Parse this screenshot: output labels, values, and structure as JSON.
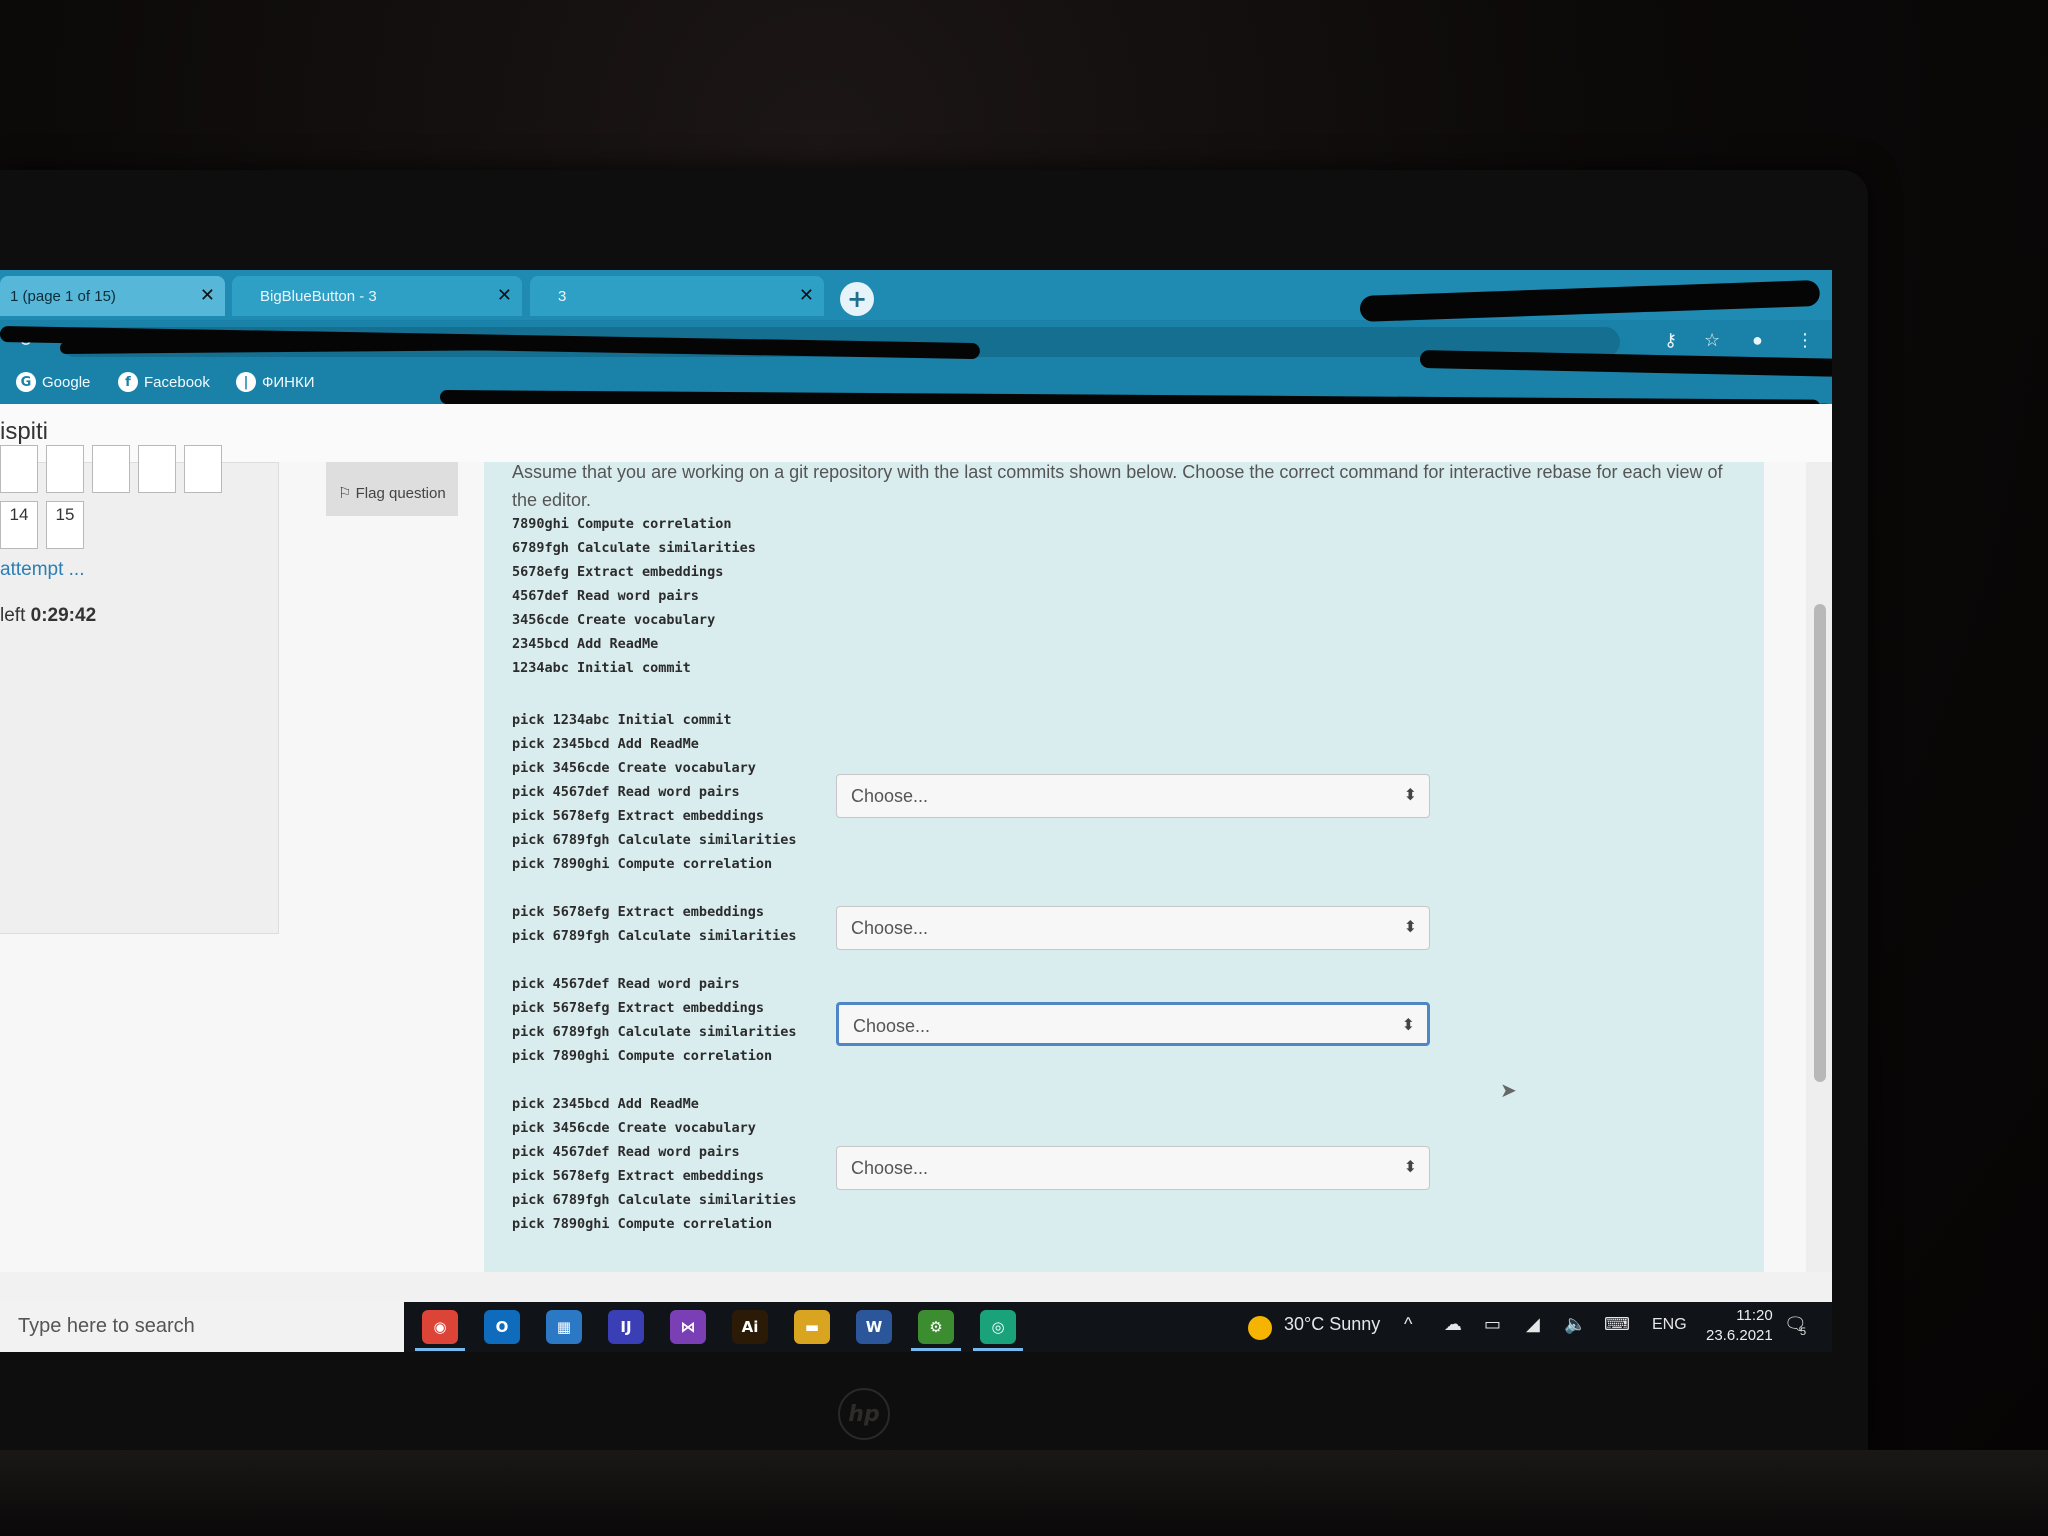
{
  "browser": {
    "tabs": [
      {
        "label": "1 (page 1 of 15)",
        "active": true
      },
      {
        "label": "BigBlueButton - 3",
        "active": false
      },
      {
        "label": "3",
        "active": false
      }
    ],
    "new_tab_label": "+",
    "bookmarks": [
      {
        "icon": "google-icon",
        "glyph": "G",
        "label": "Google"
      },
      {
        "icon": "facebook-icon",
        "glyph": "f",
        "label": "Facebook"
      },
      {
        "icon": "bookmark-icon",
        "glyph": "|",
        "label": "ФИНКИ"
      }
    ]
  },
  "site": {
    "title": "ispiti"
  },
  "quiz_nav": {
    "question_numbers": [
      "14",
      "15"
    ],
    "finish_link": "attempt ...",
    "timer_label": "left",
    "timer_value": "0:29:42"
  },
  "question_info": {
    "flag_label": "Flag question"
  },
  "question": {
    "text": "Assume that you are working on a git repository with the last commits shown below. Choose the correct command for interactive rebase for each view of the editor.",
    "log_lines": [
      "7890ghi Compute correlation",
      "6789fgh Calculate similarities",
      "5678efg Extract embeddings",
      "4567def Read word pairs",
      "3456cde Create vocabulary",
      "2345bcd Add ReadMe",
      "1234abc Initial commit"
    ],
    "editor_views": [
      {
        "lines": [
          "pick 1234abc Initial commit",
          "pick 2345bcd Add ReadMe",
          "pick 3456cde Create vocabulary",
          "pick 4567def Read word pairs",
          "pick 5678efg Extract embeddings",
          "pick 6789fgh Calculate similarities",
          "pick 7890ghi Compute correlation"
        ],
        "select_value": "Choose...",
        "focused": false
      },
      {
        "lines": [
          "pick 5678efg Extract embeddings",
          "pick 6789fgh Calculate similarities"
        ],
        "select_value": "Choose...",
        "focused": false
      },
      {
        "lines": [
          "pick 4567def Read word pairs",
          "pick 5678efg Extract embeddings",
          "pick 6789fgh Calculate similarities",
          "pick 7890ghi Compute correlation"
        ],
        "select_value": "Choose...",
        "focused": true
      },
      {
        "lines": [
          "pick 2345bcd Add ReadMe",
          "pick 3456cde Create vocabulary",
          "pick 4567def Read word pairs",
          "pick 5678efg Extract embeddings",
          "pick 6789fgh Calculate similarities",
          "pick 7890ghi Compute correlation"
        ],
        "select_value": "Choose...",
        "focused": false
      }
    ]
  },
  "taskbar": {
    "search_placeholder": "Type here to search",
    "apps": [
      {
        "icon": "chrome-icon",
        "glyph": "◉",
        "color": "#db4437",
        "active": true
      },
      {
        "icon": "outlook-icon",
        "glyph": "O",
        "color": "#0f6cbd",
        "active": false
      },
      {
        "icon": "calendar-icon",
        "glyph": "▦",
        "color": "#2b78c5",
        "active": false
      },
      {
        "icon": "intellij-icon",
        "glyph": "IJ",
        "color": "#3b3fb6",
        "active": false
      },
      {
        "icon": "visual-studio-icon",
        "glyph": "⋈",
        "color": "#7a3fb5",
        "active": false
      },
      {
        "icon": "illustrator-icon",
        "glyph": "Ai",
        "color": "#2b1a05",
        "active": false
      },
      {
        "icon": "file-explorer-icon",
        "glyph": "▬",
        "color": "#d9a521",
        "active": false
      },
      {
        "icon": "word-icon",
        "glyph": "W",
        "color": "#2b579a",
        "active": false
      },
      {
        "icon": "android-studio-icon",
        "glyph": "⚙",
        "color": "#3c8d2f",
        "active": true
      },
      {
        "icon": "chrome-alt-icon",
        "glyph": "◎",
        "color": "#1aa37a",
        "active": true
      }
    ],
    "weather": "30°C Sunny",
    "language": "ENG",
    "time": "11:20",
    "date": "23.6.2021",
    "notification_count": "5"
  }
}
